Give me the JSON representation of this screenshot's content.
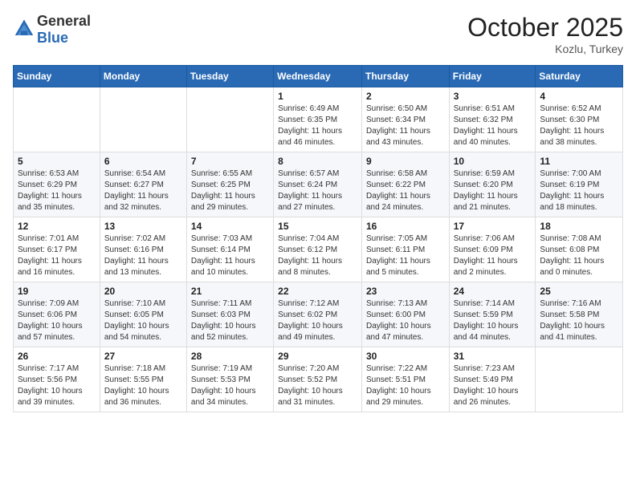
{
  "header": {
    "logo_general": "General",
    "logo_blue": "Blue",
    "month_title": "October 2025",
    "location": "Kozlu, Turkey"
  },
  "days_of_week": [
    "Sunday",
    "Monday",
    "Tuesday",
    "Wednesday",
    "Thursday",
    "Friday",
    "Saturday"
  ],
  "weeks": [
    [
      {
        "day": "",
        "info": ""
      },
      {
        "day": "",
        "info": ""
      },
      {
        "day": "",
        "info": ""
      },
      {
        "day": "1",
        "info": "Sunrise: 6:49 AM\nSunset: 6:35 PM\nDaylight: 11 hours and 46 minutes."
      },
      {
        "day": "2",
        "info": "Sunrise: 6:50 AM\nSunset: 6:34 PM\nDaylight: 11 hours and 43 minutes."
      },
      {
        "day": "3",
        "info": "Sunrise: 6:51 AM\nSunset: 6:32 PM\nDaylight: 11 hours and 40 minutes."
      },
      {
        "day": "4",
        "info": "Sunrise: 6:52 AM\nSunset: 6:30 PM\nDaylight: 11 hours and 38 minutes."
      }
    ],
    [
      {
        "day": "5",
        "info": "Sunrise: 6:53 AM\nSunset: 6:29 PM\nDaylight: 11 hours and 35 minutes."
      },
      {
        "day": "6",
        "info": "Sunrise: 6:54 AM\nSunset: 6:27 PM\nDaylight: 11 hours and 32 minutes."
      },
      {
        "day": "7",
        "info": "Sunrise: 6:55 AM\nSunset: 6:25 PM\nDaylight: 11 hours and 29 minutes."
      },
      {
        "day": "8",
        "info": "Sunrise: 6:57 AM\nSunset: 6:24 PM\nDaylight: 11 hours and 27 minutes."
      },
      {
        "day": "9",
        "info": "Sunrise: 6:58 AM\nSunset: 6:22 PM\nDaylight: 11 hours and 24 minutes."
      },
      {
        "day": "10",
        "info": "Sunrise: 6:59 AM\nSunset: 6:20 PM\nDaylight: 11 hours and 21 minutes."
      },
      {
        "day": "11",
        "info": "Sunrise: 7:00 AM\nSunset: 6:19 PM\nDaylight: 11 hours and 18 minutes."
      }
    ],
    [
      {
        "day": "12",
        "info": "Sunrise: 7:01 AM\nSunset: 6:17 PM\nDaylight: 11 hours and 16 minutes."
      },
      {
        "day": "13",
        "info": "Sunrise: 7:02 AM\nSunset: 6:16 PM\nDaylight: 11 hours and 13 minutes."
      },
      {
        "day": "14",
        "info": "Sunrise: 7:03 AM\nSunset: 6:14 PM\nDaylight: 11 hours and 10 minutes."
      },
      {
        "day": "15",
        "info": "Sunrise: 7:04 AM\nSunset: 6:12 PM\nDaylight: 11 hours and 8 minutes."
      },
      {
        "day": "16",
        "info": "Sunrise: 7:05 AM\nSunset: 6:11 PM\nDaylight: 11 hours and 5 minutes."
      },
      {
        "day": "17",
        "info": "Sunrise: 7:06 AM\nSunset: 6:09 PM\nDaylight: 11 hours and 2 minutes."
      },
      {
        "day": "18",
        "info": "Sunrise: 7:08 AM\nSunset: 6:08 PM\nDaylight: 11 hours and 0 minutes."
      }
    ],
    [
      {
        "day": "19",
        "info": "Sunrise: 7:09 AM\nSunset: 6:06 PM\nDaylight: 10 hours and 57 minutes."
      },
      {
        "day": "20",
        "info": "Sunrise: 7:10 AM\nSunset: 6:05 PM\nDaylight: 10 hours and 54 minutes."
      },
      {
        "day": "21",
        "info": "Sunrise: 7:11 AM\nSunset: 6:03 PM\nDaylight: 10 hours and 52 minutes."
      },
      {
        "day": "22",
        "info": "Sunrise: 7:12 AM\nSunset: 6:02 PM\nDaylight: 10 hours and 49 minutes."
      },
      {
        "day": "23",
        "info": "Sunrise: 7:13 AM\nSunset: 6:00 PM\nDaylight: 10 hours and 47 minutes."
      },
      {
        "day": "24",
        "info": "Sunrise: 7:14 AM\nSunset: 5:59 PM\nDaylight: 10 hours and 44 minutes."
      },
      {
        "day": "25",
        "info": "Sunrise: 7:16 AM\nSunset: 5:58 PM\nDaylight: 10 hours and 41 minutes."
      }
    ],
    [
      {
        "day": "26",
        "info": "Sunrise: 7:17 AM\nSunset: 5:56 PM\nDaylight: 10 hours and 39 minutes."
      },
      {
        "day": "27",
        "info": "Sunrise: 7:18 AM\nSunset: 5:55 PM\nDaylight: 10 hours and 36 minutes."
      },
      {
        "day": "28",
        "info": "Sunrise: 7:19 AM\nSunset: 5:53 PM\nDaylight: 10 hours and 34 minutes."
      },
      {
        "day": "29",
        "info": "Sunrise: 7:20 AM\nSunset: 5:52 PM\nDaylight: 10 hours and 31 minutes."
      },
      {
        "day": "30",
        "info": "Sunrise: 7:22 AM\nSunset: 5:51 PM\nDaylight: 10 hours and 29 minutes."
      },
      {
        "day": "31",
        "info": "Sunrise: 7:23 AM\nSunset: 5:49 PM\nDaylight: 10 hours and 26 minutes."
      },
      {
        "day": "",
        "info": ""
      }
    ]
  ]
}
